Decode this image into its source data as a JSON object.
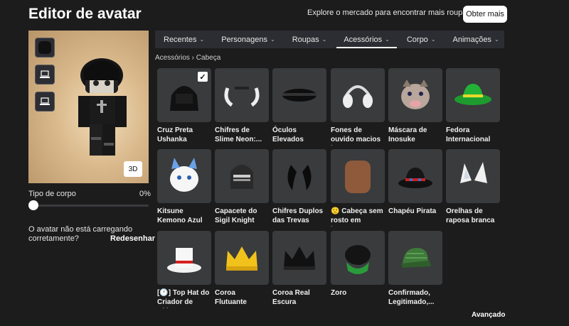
{
  "header": {
    "title": "Editor de avatar",
    "promo_text": "Explore o mercado para encontrar mais roupas!",
    "get_more_label": "Obter mais"
  },
  "preview": {
    "btn3d_label": "3D",
    "body_type_label": "Tipo de corpo",
    "body_type_value": "0%",
    "body_type_fraction": 0,
    "warning": "O avatar não está carregando corretamente?",
    "redraw_label": "Redesenhar"
  },
  "tabs": [
    {
      "label": "Recentes"
    },
    {
      "label": "Personagens"
    },
    {
      "label": "Roupas"
    },
    {
      "label": "Acessórios",
      "active": true
    },
    {
      "label": "Corpo"
    },
    {
      "label": "Animações"
    }
  ],
  "breadcrumb": "Acessórios › Cabeça",
  "items": [
    {
      "name": "Cruz Preta Ushanka",
      "icon": "black-ushanka-icon",
      "selected": true
    },
    {
      "name": "Chifres de Slime Neon:...",
      "icon": "slime-horns-icon"
    },
    {
      "name": "Óculos Elevados Negros",
      "icon": "black-goggles-icon"
    },
    {
      "name": "Fones de ouvido macios brancos...",
      "icon": "white-headphones-icon"
    },
    {
      "name": "Máscara de Inosuke",
      "icon": "boar-mask-icon"
    },
    {
      "name": "Fedora Internacional –...",
      "icon": "green-fedora-icon"
    },
    {
      "name": "Kitsune Kemono Azul",
      "icon": "kitsune-mask-icon"
    },
    {
      "name": "Capacete do Sigil Knight",
      "icon": "knight-helmet-icon"
    },
    {
      "name": "Chifres Duplos das Trevas",
      "icon": "dark-horns-icon"
    },
    {
      "name": "🙂 Cabeça sem rosto em branc...",
      "icon": "faceless-head-icon"
    },
    {
      "name": "Chapéu Pirata",
      "icon": "pirate-hat-icon"
    },
    {
      "name": "Orelhas de raposa branca –...",
      "icon": "fox-ears-icon"
    },
    {
      "name": "[🕐] Top Hat do Criador de Vídeo",
      "icon": "white-tophat-icon"
    },
    {
      "name": "Coroa Flutuante",
      "icon": "gold-crown-icon"
    },
    {
      "name": "Coroa Real Escura",
      "icon": "dark-crown-icon"
    },
    {
      "name": "Zoro",
      "icon": "zoro-head-icon"
    },
    {
      "name": "Confirmado, Legitimado,...",
      "icon": "green-cap-icon"
    }
  ],
  "advanced_label": "Avançado"
}
